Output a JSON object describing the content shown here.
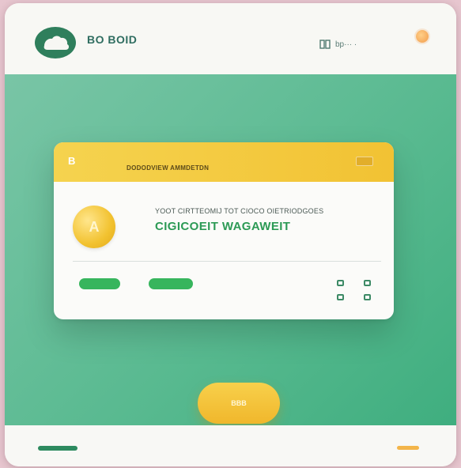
{
  "header": {
    "brand": "BO BOID",
    "nav_text": "bp··· ·",
    "accent_dot_color": "#f29c4b"
  },
  "card": {
    "tag": "B",
    "subtitle": "DODODVIEW AMMDETDN",
    "line1": "YOOT CIRTTEOMIJ TOT CIOCO OIETRIODGOES",
    "headline": "CIGICOEIT WAGAWEIT",
    "coin_symbol": "A",
    "accent_color": "#f2c233",
    "success_color": "#37b55d"
  },
  "cta": {
    "label": "BBB"
  },
  "icons": {
    "logo": "cloud-logo-icon",
    "nav": "grid-icon",
    "account": "avatar-dot-icon",
    "coin": "coin-icon",
    "actions": [
      "square-icon",
      "square-icon",
      "square-icon",
      "square-icon"
    ]
  }
}
